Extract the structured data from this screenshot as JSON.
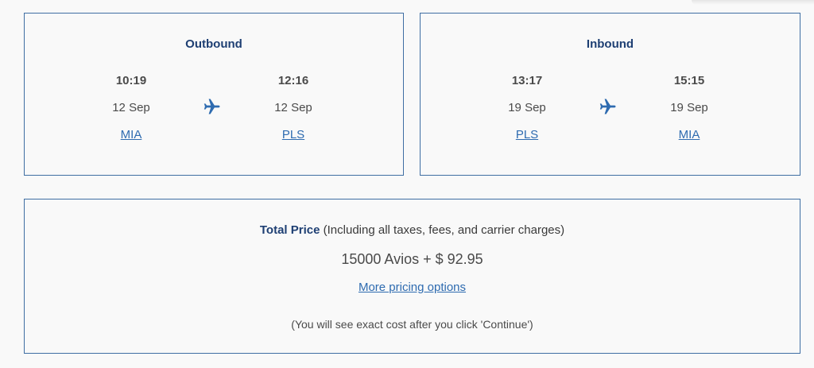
{
  "colors": {
    "border": "#3f6ea3",
    "title": "#1e3f73",
    "link": "#2e6bb0",
    "text": "#4a4a4a",
    "background": "#f9f9f9"
  },
  "outbound": {
    "title": "Outbound",
    "departure": {
      "time": "10:19",
      "date": "12 Sep",
      "airport": "MIA"
    },
    "arrival": {
      "time": "12:16",
      "date": "12 Sep",
      "airport": "PLS"
    },
    "icon": "airplane-icon"
  },
  "inbound": {
    "title": "Inbound",
    "departure": {
      "time": "13:17",
      "date": "19 Sep",
      "airport": "PLS"
    },
    "arrival": {
      "time": "15:15",
      "date": "19 Sep",
      "airport": "MIA"
    },
    "icon": "airplane-icon"
  },
  "price": {
    "label": "Total Price",
    "qualifier": "(Including all taxes, fees, and carrier charges)",
    "amount": "15000 Avios + $ 92.95",
    "more_options": "More pricing options",
    "note": "(You will see exact cost after you click 'Continue')"
  }
}
